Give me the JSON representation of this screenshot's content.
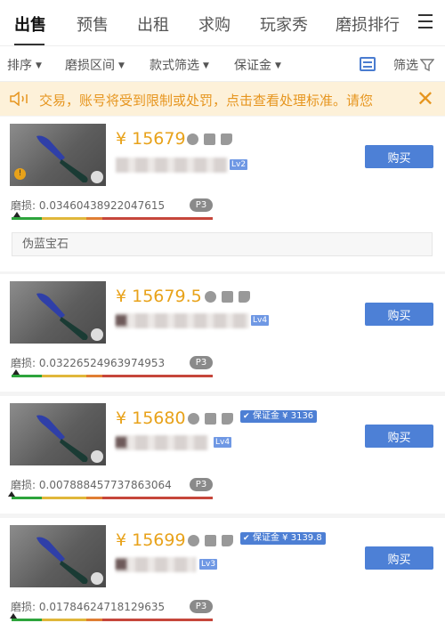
{
  "tabs": [
    "出售",
    "预售",
    "出租",
    "求购",
    "玩家秀",
    "磨损排行"
  ],
  "active_tab": 0,
  "filters": {
    "sort": "排序",
    "wear_range": "磨损区间",
    "style": "款式筛选",
    "deposit": "保证金",
    "filter": "筛选"
  },
  "notice": {
    "text": "交易，账号将受到限制或处罚，点击查看处理标准。请您"
  },
  "buy_label": "购买",
  "wear_prefix": "磨损:",
  "listings": [
    {
      "price": "¥ 15679",
      "level": "Lv2",
      "wear": "0.03460438922047615",
      "pattern": "P3",
      "wear_value": 0.0346,
      "sticker": "伪蓝宝石"
    },
    {
      "price": "¥ 15679.5",
      "level": "Lv4",
      "wear": "0.03226524963974953",
      "pattern": "P3",
      "wear_value": 0.0323
    },
    {
      "price": "¥ 15680",
      "level": "Lv4",
      "wear": "0.007888457737863064",
      "pattern": "P3",
      "wear_value": 0.0079,
      "guarantee": "保证金 ¥ 3136"
    },
    {
      "price": "¥ 15699",
      "level": "Lv3",
      "wear": "0.01784624718129635",
      "pattern": "P3",
      "wear_value": 0.0178,
      "guarantee": "保证金 ¥ 3139.8"
    }
  ]
}
